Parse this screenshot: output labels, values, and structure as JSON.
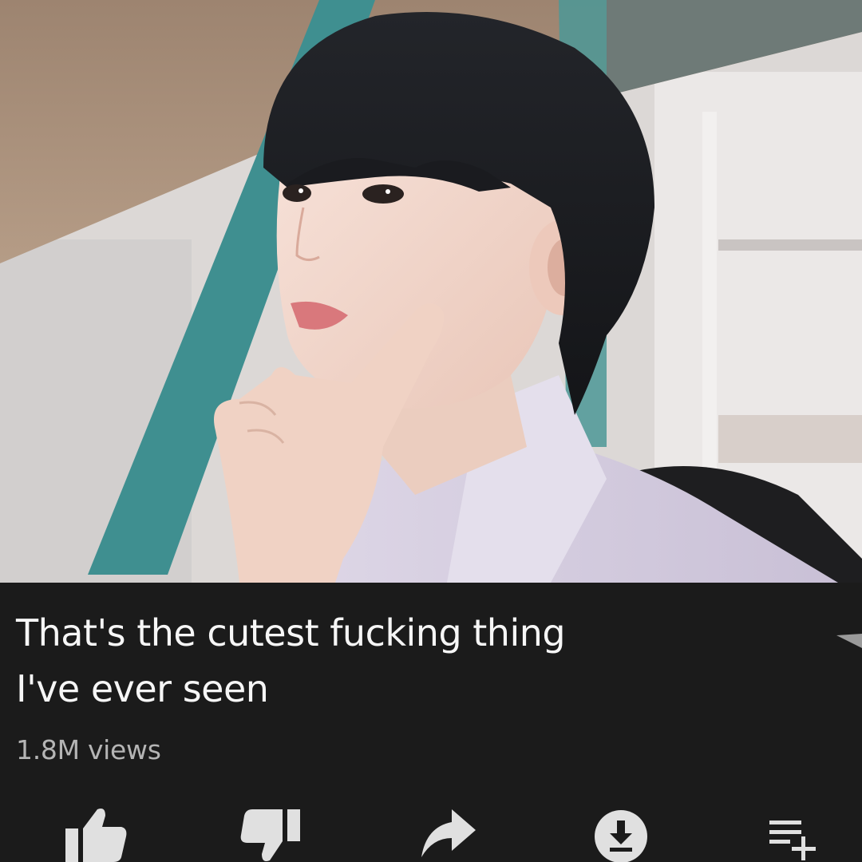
{
  "video": {
    "title": "That's the cutest fucking thing I've ever seen",
    "views": "1.8M views"
  },
  "actions": [
    {
      "icon": "thumbs-up-icon"
    },
    {
      "icon": "thumbs-down-icon"
    },
    {
      "icon": "share-icon"
    },
    {
      "icon": "download-icon"
    },
    {
      "icon": "save-to-playlist-icon"
    }
  ],
  "colors": {
    "panel_background": "#1b1b1b",
    "title_text": "#f6f6f6",
    "secondary_text": "#b5b5b5",
    "icon": "#e0e0e0"
  }
}
